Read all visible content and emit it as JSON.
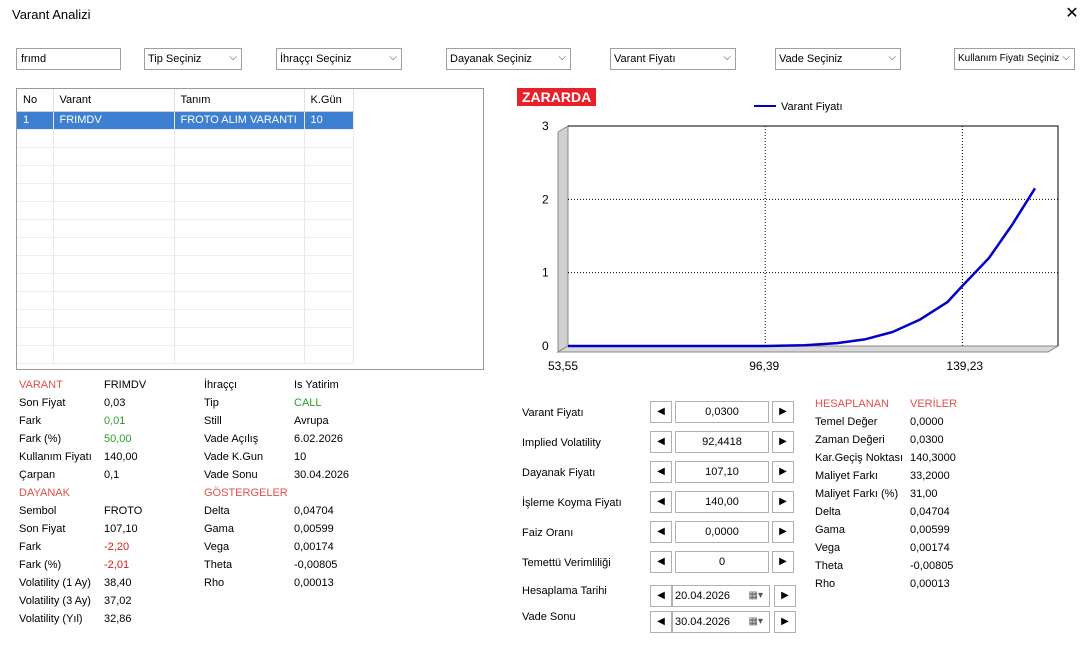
{
  "window": {
    "title": "Varant  Analizi",
    "close": "✕"
  },
  "filters": {
    "search_value": "frımd",
    "tip": "Tip Seçiniz",
    "ihracci": "İhraççı Seçiniz",
    "dayanak": "Dayanak Seçiniz",
    "varant_fiyati": "Varant Fiyatı",
    "vade": "Vade Seçiniz",
    "kullanim": "Kullanım Fiyatı Seçiniz"
  },
  "grid": {
    "headers": [
      "No",
      "Varant",
      "Tanım",
      "K.Gün"
    ],
    "rows": [
      [
        "1",
        "FRIMDV",
        "FROTO ALIM VARANTI",
        "10"
      ]
    ]
  },
  "varant": {
    "section": "VARANT",
    "symbol": "FRIMDV",
    "rows": [
      {
        "k": "Son Fiyat",
        "v": "0,03"
      },
      {
        "k": "Fark",
        "v": "0,01"
      },
      {
        "k": "Fark (%)",
        "v": "50,00"
      },
      {
        "k": "Kullanım Fiyatı",
        "v": "140,00"
      },
      {
        "k": "Çarpan",
        "v": "0,1"
      }
    ]
  },
  "dayanak": {
    "section": "DAYANAK",
    "rows": [
      {
        "k": "Sembol",
        "v": "FROTO"
      },
      {
        "k": "Son Fiyat",
        "v": "107,10"
      },
      {
        "k": "Fark",
        "v": "-2,20"
      },
      {
        "k": "Fark (%)",
        "v": "-2,01"
      },
      {
        "k": "Volatility (1 Ay)",
        "v": "38,40"
      },
      {
        "k": "Volatility (3 Ay)",
        "v": "37,02"
      },
      {
        "k": "Volatility (Yıl)",
        "v": "32,86"
      }
    ]
  },
  "info": {
    "rows": [
      {
        "k": "İhraççı",
        "v": "Is Yatirim"
      },
      {
        "k": "Tip",
        "v": "CALL"
      },
      {
        "k": "Still",
        "v": "Avrupa"
      },
      {
        "k": "Vade Açılış",
        "v": "6.02.2026"
      },
      {
        "k": "Vade K.Gun",
        "v": "10"
      },
      {
        "k": "Vade Sonu",
        "v": "30.04.2026"
      }
    ]
  },
  "gostergeler": {
    "section": "GÖSTERGELER",
    "rows": [
      {
        "k": "Delta",
        "v": "0,04704"
      },
      {
        "k": "Gama",
        "v": "0,00599"
      },
      {
        "k": "Vega",
        "v": "0,00174"
      },
      {
        "k": "Theta",
        "v": "-0,00805"
      },
      {
        "k": "Rho",
        "v": "0,00013"
      }
    ]
  },
  "status_badge": "ZARARDA",
  "chart_data": {
    "type": "line",
    "series": [
      {
        "name": "Varant Fiyatı",
        "color": "#0000c8",
        "x": [
          53.55,
          70,
          85,
          96.39,
          105,
          112,
          118,
          124,
          130,
          136,
          139.23,
          145,
          150,
          155
        ],
        "y": [
          0.0,
          0.0,
          0.0,
          0.0,
          0.01,
          0.04,
          0.09,
          0.19,
          0.36,
          0.6,
          0.82,
          1.2,
          1.65,
          2.15
        ]
      }
    ],
    "xticks": [
      "53,55",
      "96,39",
      "139,23"
    ],
    "yticks": [
      "0",
      "1",
      "2",
      "3"
    ],
    "xlim": [
      53.55,
      160
    ],
    "ylim": [
      0,
      3
    ],
    "grid": true,
    "legend": "top"
  },
  "calculator": {
    "rows": [
      {
        "label": "Varant Fiyatı",
        "value": "0,0300"
      },
      {
        "label": "Implied Volatility",
        "value": "92,4418"
      },
      {
        "label": "Dayanak Fiyatı",
        "value": "107,10"
      },
      {
        "label": "İşleme Koyma Fiyatı",
        "value": "140,00"
      },
      {
        "label": "Faiz Oranı",
        "value": "0,0000"
      },
      {
        "label": "Temettü Verimliliği",
        "value": "0"
      }
    ],
    "dates": [
      {
        "label": "Hesaplama Tarihi",
        "value": "20.04.2026"
      },
      {
        "label": "Vade Sonu",
        "value": "30.04.2026"
      }
    ],
    "left_arrow": "◀",
    "right_arrow": "▶"
  },
  "hesaplanan": {
    "section1": "HESAPLANAN",
    "section2": "VERİLER",
    "rows": [
      {
        "k": "Temel Değer",
        "v": "0,0000"
      },
      {
        "k": "Zaman Değeri",
        "v": "0,0300"
      },
      {
        "k": "Kar.Geçiş Noktası",
        "v": "140,3000"
      },
      {
        "k": "Maliyet Farkı",
        "v": "33,2000"
      },
      {
        "k": "Maliyet Farkı (%)",
        "v": "31,00"
      },
      {
        "k": "Delta",
        "v": "0,04704"
      },
      {
        "k": "Gama",
        "v": "0,00599"
      },
      {
        "k": "Vega",
        "v": "0,00174"
      },
      {
        "k": "Theta",
        "v": "-0,00805"
      },
      {
        "k": "Rho",
        "v": "0,00013"
      }
    ]
  }
}
